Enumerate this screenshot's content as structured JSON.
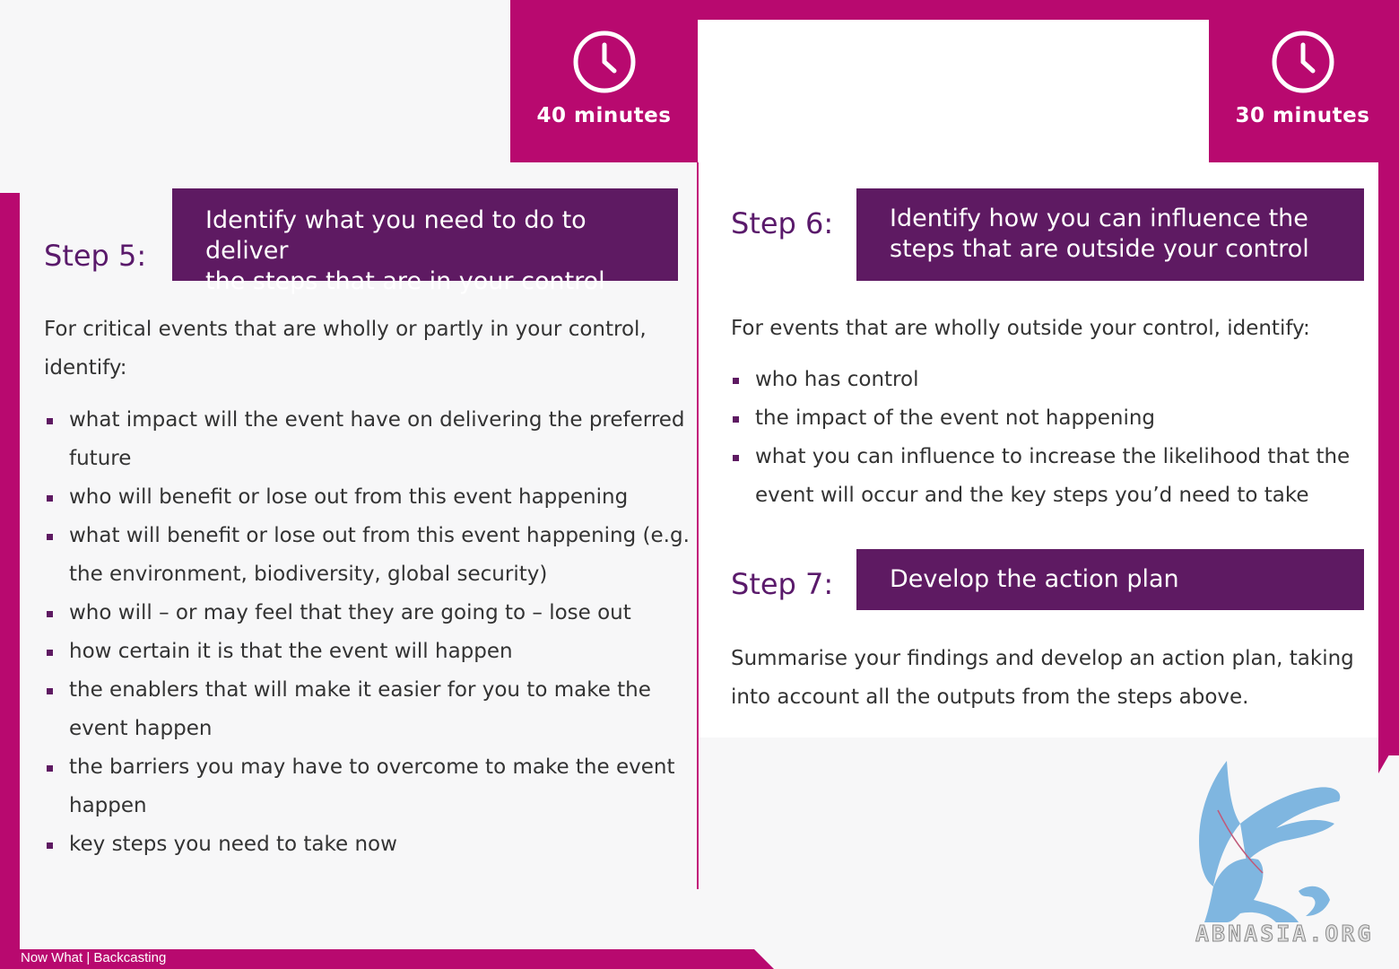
{
  "timers": [
    {
      "label": "40 minutes",
      "icon": "clock-icon"
    },
    {
      "label": "30 minutes",
      "icon": "clock-icon"
    }
  ],
  "step5": {
    "label": "Step 5:",
    "banner": [
      "Identify what you need to do to deliver",
      "the steps that are in your control"
    ],
    "intro": [
      "For critical events that are wholly or partly in your control,",
      "identify:"
    ],
    "bullets": [
      [
        "what impact will the event have on delivering the preferred",
        "future"
      ],
      [
        "who will benefit or lose out from this event happening"
      ],
      [
        "what will benefit or lose out from this event happening (e.g.",
        "the environment, biodiversity, global security)"
      ],
      [
        "who will – or may feel that they are going to – lose out"
      ],
      [
        "how certain it is that the event will happen"
      ],
      [
        "the enablers that will make it easier for you to make the",
        "event happen"
      ],
      [
        "the barriers you may have to overcome to make the event",
        "happen"
      ],
      [
        "key steps you need to take now"
      ]
    ]
  },
  "step6": {
    "label": "Step 6:",
    "banner": [
      "Identify how you can influence the",
      "steps that are outside your control"
    ],
    "intro": "For events that are wholly outside your control, identify:",
    "bullets": [
      [
        "who has control"
      ],
      [
        "the impact of the event not happening"
      ],
      [
        "what you can influence to increase the likelihood that the",
        "event will occur and the key steps you’d need to take"
      ]
    ]
  },
  "step7": {
    "label": "Step 7:",
    "banner": "Develop the action plan",
    "body": [
      "Summarise your findings and develop an action plan, taking",
      "into account all the outputs from the steps above."
    ]
  },
  "footer": "Now What | Backcasting",
  "logo_text": "ABNASIA.ORG",
  "colors": {
    "magenta": "#b8096f",
    "purple": "#5e1a62",
    "step_label": "#5a1a6b",
    "logo_blue": "#7fb6e0"
  }
}
